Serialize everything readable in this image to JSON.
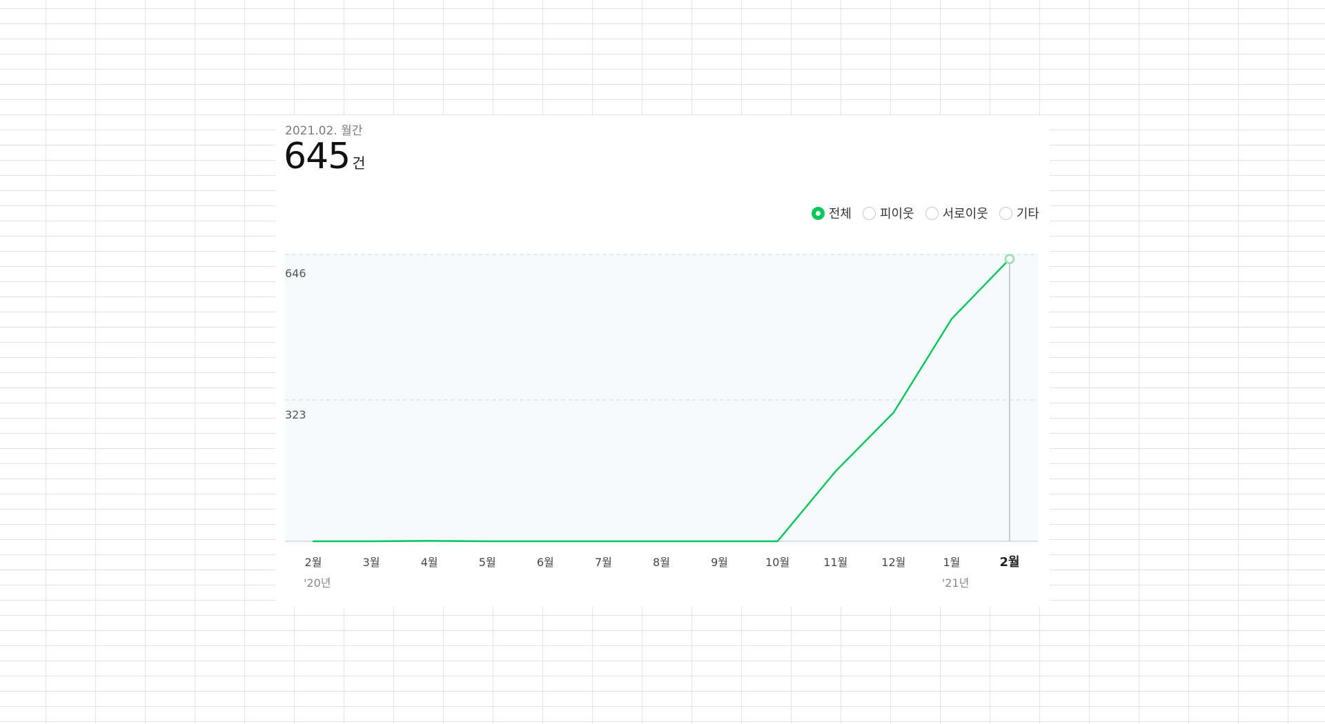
{
  "header": {
    "period_label": "2021.02. 월간",
    "total_value": "645",
    "total_unit": "건"
  },
  "filters": [
    {
      "label": "전체",
      "checked": true
    },
    {
      "label": "피이웃",
      "checked": false
    },
    {
      "label": "서로이웃",
      "checked": false
    },
    {
      "label": "기타",
      "checked": false
    }
  ],
  "colors": {
    "accent": "#03c75a",
    "plot_background": "#f6fafd",
    "gridline": "#dbe4ec",
    "marker_fill": "#9ee2b7"
  },
  "chart_data": {
    "type": "line",
    "categories": [
      "2월",
      "3월",
      "4월",
      "5월",
      "6월",
      "7월",
      "8월",
      "9월",
      "10월",
      "11월",
      "12월",
      "1월",
      "2월"
    ],
    "year_labels": [
      {
        "index": 0,
        "text": "'20년"
      },
      {
        "index": 11,
        "text": "'21년"
      }
    ],
    "series": [
      {
        "values": [
          0,
          0,
          1,
          0,
          0,
          0,
          0,
          0,
          0,
          160,
          294,
          508,
          645
        ]
      }
    ],
    "y_ticks": [
      {
        "value": 323,
        "label": "323"
      },
      {
        "value": 646,
        "label": "646"
      }
    ],
    "ylim": [
      0,
      646
    ],
    "highlight_index": 12,
    "grid": true
  }
}
